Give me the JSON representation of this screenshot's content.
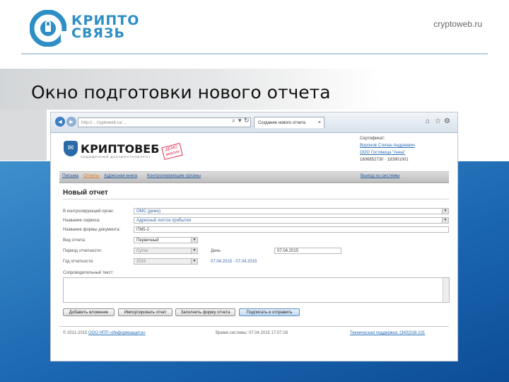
{
  "slide": {
    "logo_line1": "КРИПТО",
    "logo_line2": "СВЯЗЬ",
    "site_url": "cryptoweb.ru",
    "title": "Окно подготовки нового отчета"
  },
  "browser": {
    "address": "http://... cryptoweb.ru/ ...",
    "tab_label": "Создание нового отчета",
    "back_icon": "arrow-left-icon",
    "forward_icon": "arrow-right-icon",
    "home_icon": "home-icon",
    "star_icon": "star-icon",
    "gear_icon": "gear-icon"
  },
  "app": {
    "brand": "КРИПТОВЕБ",
    "brand_sub": "ЗАЩИЩЕННЫЙ ДОКУМЕНТООБОРОТ",
    "demo_badge": "ДЕМО версия",
    "certificate": {
      "label": "Сертификат:",
      "owner": "Воронов Степан Андреевич",
      "org": "ООО Гостиница \"Анна\"",
      "numbers": "1806852730 · 183901001"
    },
    "menu": {
      "items": [
        "Письма",
        "Отчеты",
        "Адресная книга",
        "Контролирующие органы"
      ],
      "active_index": 1,
      "logout": "Выход из системы"
    }
  },
  "form": {
    "title": "Новый отчет",
    "authority_label": "В контролирующий орган:",
    "authority_value": "ОМС (демо)",
    "service_label": "Название сервиса:",
    "service_value": "Адресный листок прибытия",
    "form_name_label": "Название формы документа:",
    "form_name_value": "ПМ5-2",
    "report_kind_label": "Вид отчета:",
    "report_kind_value": "Первичный",
    "period_label": "Период отчетности:",
    "period_value": "Сутки",
    "day_label": "День",
    "day_value": "07.04.2015",
    "year_label": "Год отчетности:",
    "year_value": "2015",
    "date_range": "07.04.2015 - 07.04.2015",
    "cover_text_label": "Сопроводительный текст:",
    "buttons": {
      "attach": "Добавить вложение",
      "import": "Импортировать отчет",
      "fill": "Заполнить форму отчета",
      "sign_send": "Подписать и отправить"
    }
  },
  "footer": {
    "copyright_prefix": "© 2011-2015",
    "copyright_link": "ООО НПП «Информзащита»",
    "system_time": "Время системы: 07.04.2015 17:07:28",
    "support_link": "Техническая поддержка: (343)318-101"
  }
}
